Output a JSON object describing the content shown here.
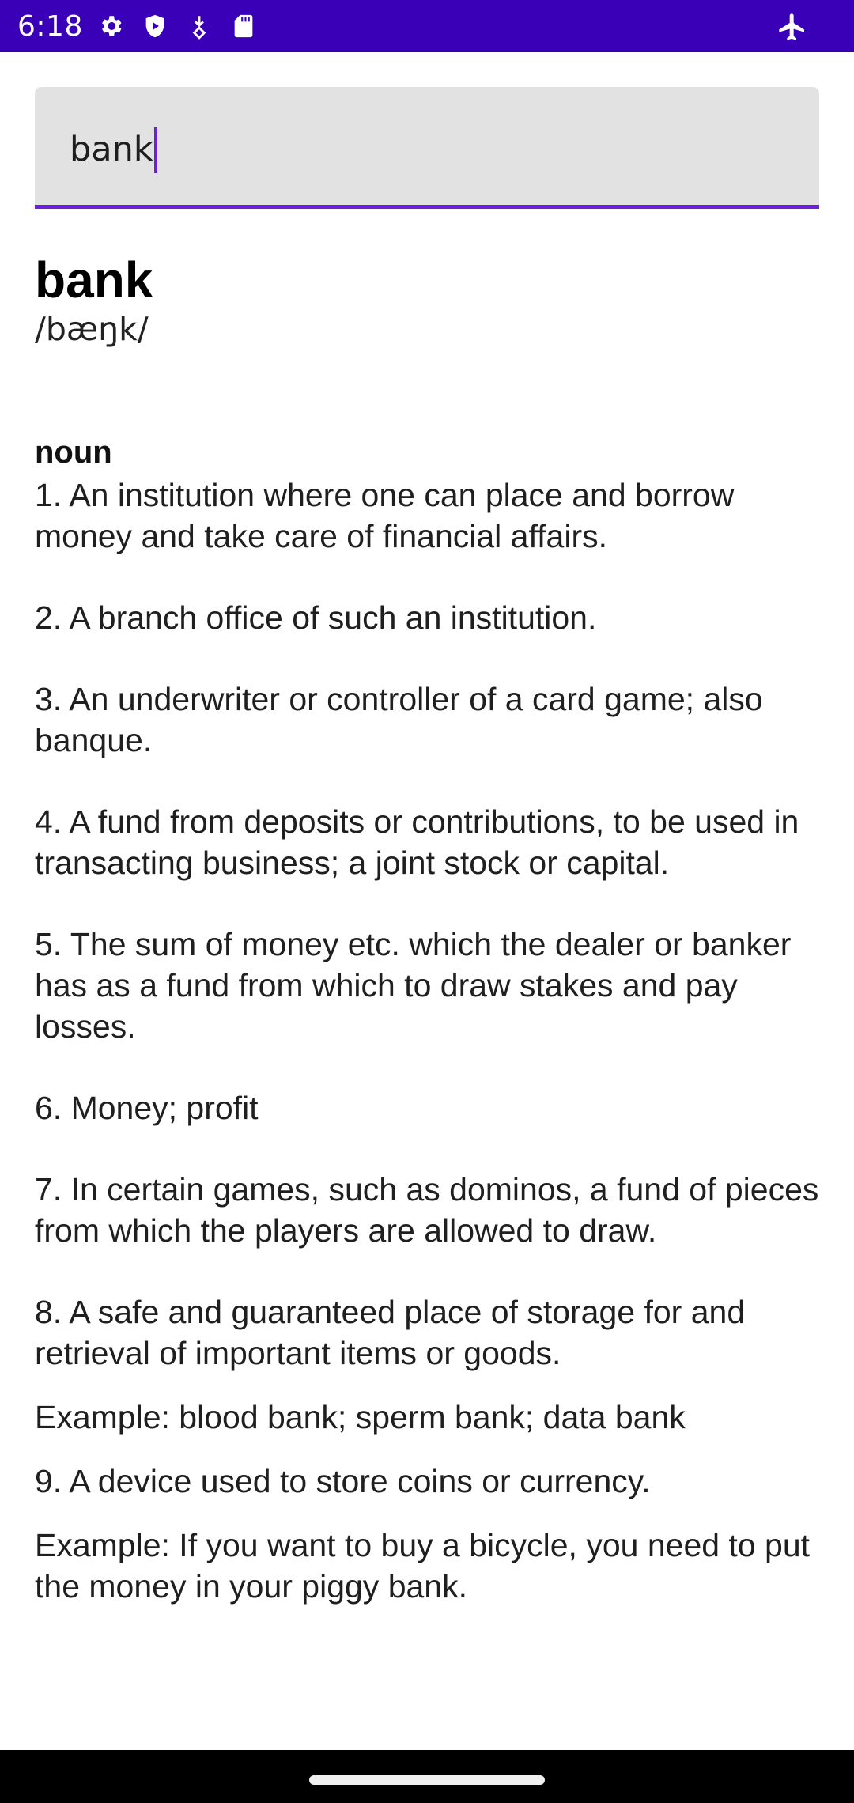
{
  "status_bar": {
    "time": "6:18",
    "icons": [
      "gear-icon",
      "shield-icon",
      "download-icon",
      "sd-card-icon",
      "airplane-icon"
    ]
  },
  "colors": {
    "status_bar_bg": "#3a00b8",
    "accent": "#6a21d8",
    "search_bg": "#e2e2e2"
  },
  "search": {
    "value": "bank"
  },
  "entry": {
    "word": "bank",
    "phonetic": "/bæŋk/",
    "part_of_speech": "noun",
    "definitions": [
      "1. An institution where one can place and borrow money and take care of financial affairs.",
      "2. A branch office of such an institution.",
      "3. An underwriter or controller of a card game; also banque.",
      "4. A fund from deposits or contributions, to be used in transacting business; a joint stock or capital.",
      "5. The sum of money etc. which the dealer or banker has as a fund from which to draw stakes and pay losses.",
      "6. Money; profit",
      "7. In certain games, such as dominos, a fund of pieces from which the players are allowed to draw.",
      "8. A safe and guaranteed place of storage for and retrieval of important items or goods.",
      "9. A device used to store coins or currency."
    ],
    "examples": {
      "def8": "Example: blood bank; sperm bank; data bank",
      "def9": "Example: If you want to buy a bicycle, you need to put the money in your piggy bank."
    }
  }
}
